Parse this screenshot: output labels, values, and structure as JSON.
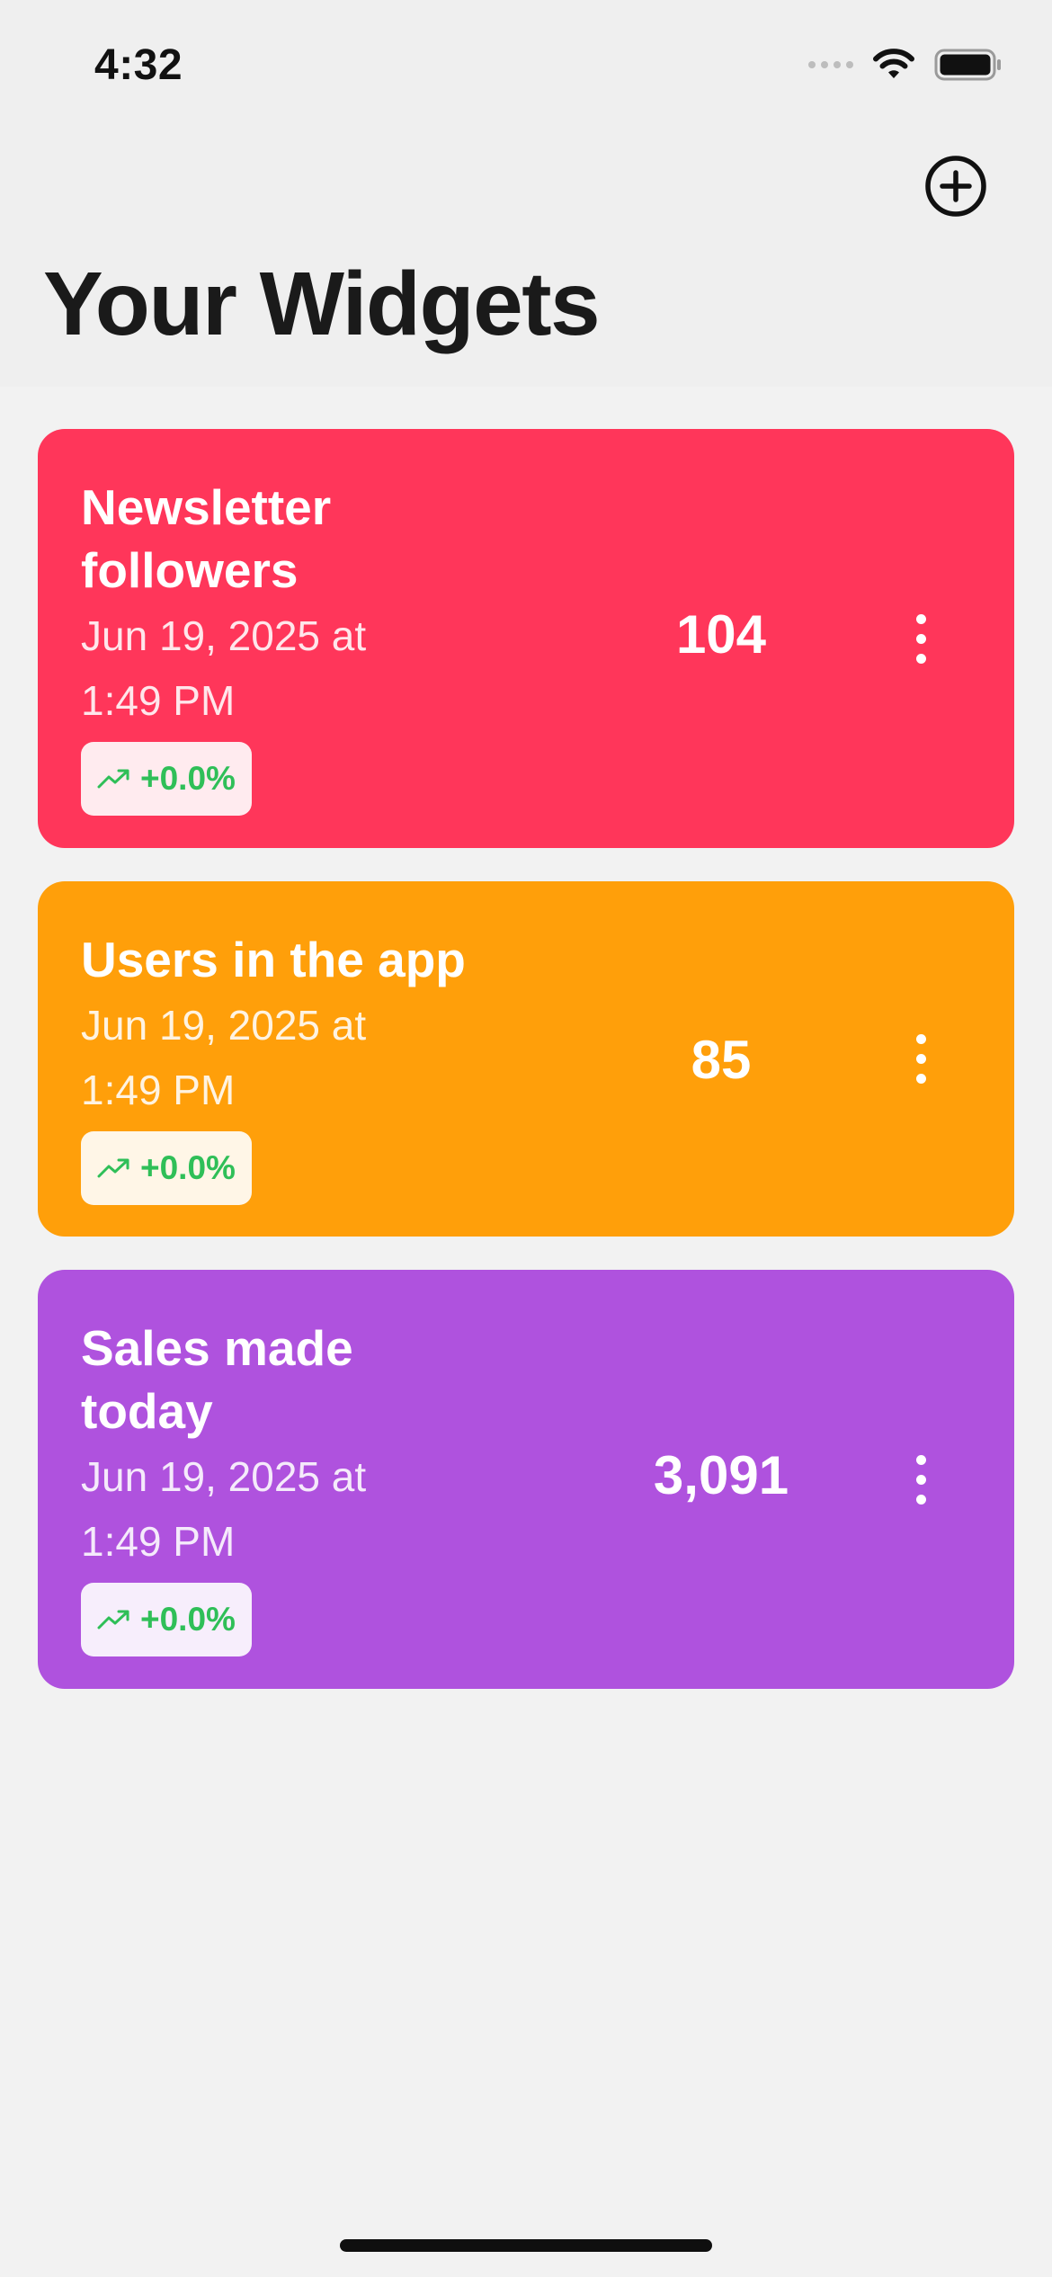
{
  "status_bar": {
    "time": "4:32"
  },
  "header": {
    "title": "Your Widgets",
    "add_icon": "plus-circle-icon"
  },
  "widgets": [
    {
      "title": "Newsletter followers",
      "date_line1": "Jun 19, 2025 at",
      "date_line2": "1:49 PM",
      "trend": "+0.0%",
      "value": "104",
      "color": "#ff365a"
    },
    {
      "title": "Users in the app",
      "date_line1": "Jun 19, 2025 at",
      "date_line2": "1:49 PM",
      "trend": "+0.0%",
      "value": "85",
      "color": "#ff9f0a"
    },
    {
      "title": "Sales made today",
      "date_line1": "Jun 19, 2025 at",
      "date_line2": "1:49 PM",
      "trend": "+0.0%",
      "value": "3,091",
      "color": "#af52de"
    }
  ],
  "colors": {
    "trend_positive": "#2fbf58",
    "background": "#f2f2f2"
  }
}
